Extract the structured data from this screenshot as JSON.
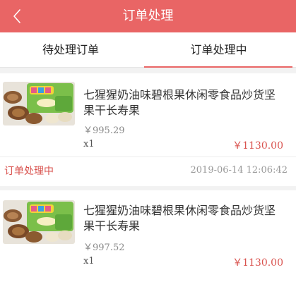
{
  "header": {
    "title": "订单处理",
    "back_icon": "chevron-left-icon"
  },
  "tabs": [
    {
      "label": "待处理订单",
      "active": false
    },
    {
      "label": "订单处理中",
      "active": true
    }
  ],
  "orders": [
    {
      "product_name": "七猩猩奶油味碧根果休闲零食品炒货坚果干长寿果",
      "unit_price": "￥995.29",
      "quantity": "x1",
      "total": "￥1130.00",
      "status": "订单处理中",
      "timestamp": "2019-06-14 12:06:42"
    },
    {
      "product_name": "七猩猩奶油味碧根果休闲零食品炒货坚果干长寿果",
      "unit_price": "￥997.52",
      "quantity": "x1",
      "total": "￥1130.00"
    }
  ],
  "colors": {
    "brand": "#e96565",
    "accent_text": "#d9534f"
  }
}
